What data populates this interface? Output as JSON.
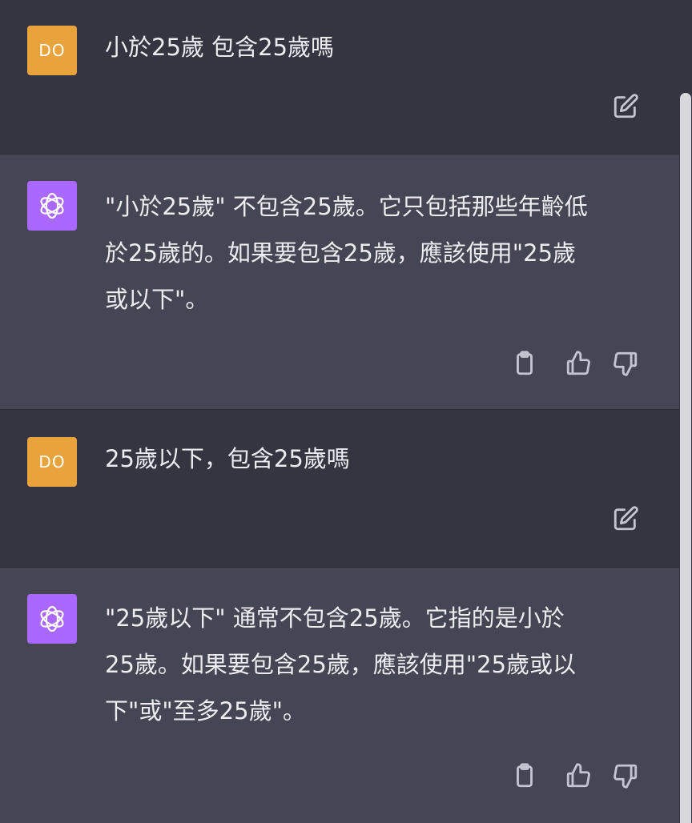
{
  "conversation": [
    {
      "role": "user",
      "avatar_initials": "DO",
      "text": "小於25歲 包含25歲嗎",
      "edit_icon": "edit-icon"
    },
    {
      "role": "assistant",
      "avatar_icon": "openai-logo-icon",
      "lines": [
        "\"小於25歲\" 不包含25歲。它只包括那些年齡低",
        "於25歲的。如果要包含25歲，應該使用\"25歲",
        "或以下\"。"
      ],
      "actions": [
        "clipboard-icon",
        "thumbs-up-icon",
        "thumbs-down-icon"
      ]
    },
    {
      "role": "user",
      "avatar_initials": "DO",
      "text": "25歲以下，包含25歲嗎",
      "edit_icon": "edit-icon"
    },
    {
      "role": "assistant",
      "avatar_icon": "openai-logo-icon",
      "lines": [
        "\"25歲以下\" 通常不包含25歲。它指的是小於",
        "25歲。如果要包含25歲，應該使用\"25歲或以",
        "下\"或\"至多25歲\"。"
      ],
      "actions": [
        "clipboard-icon",
        "thumbs-up-icon",
        "thumbs-down-icon"
      ]
    }
  ],
  "colors": {
    "user_bg": "#343541",
    "assistant_bg": "#444654",
    "user_avatar": "#e8a33d",
    "assistant_avatar": "#ab68ff"
  }
}
